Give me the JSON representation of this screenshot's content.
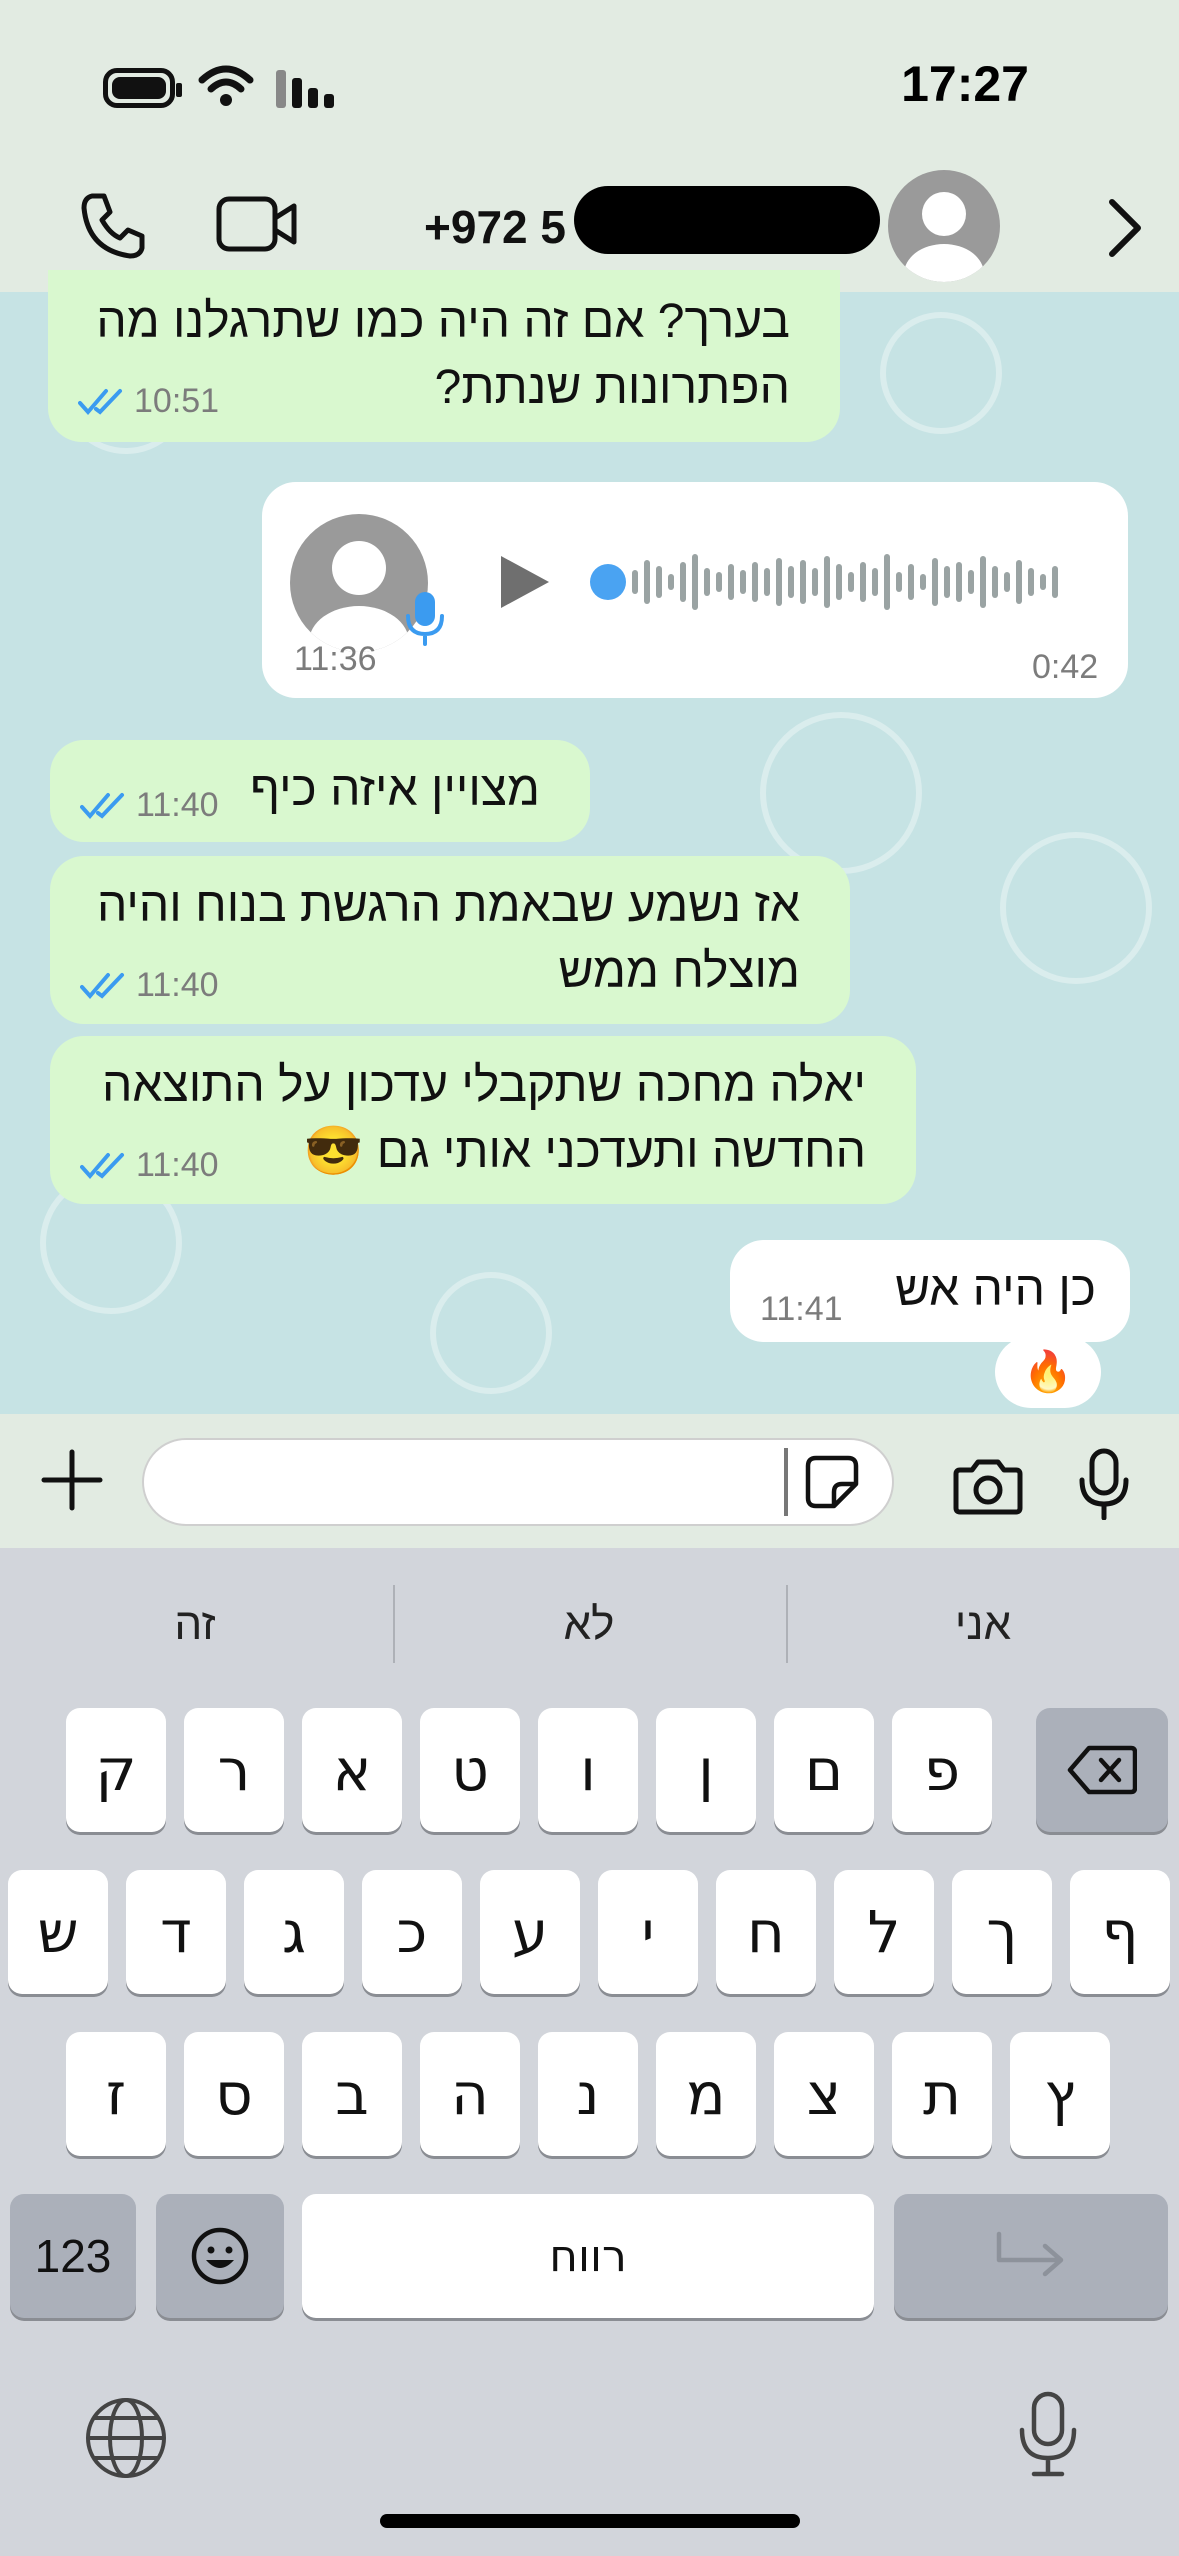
{
  "status": {
    "time": "17:27"
  },
  "header": {
    "contact": "+972 5"
  },
  "messages": {
    "m1": {
      "text1": "בערך? אם זה היה כמו שתרגלנו מה",
      "text2": "הפתרונות שנתת?",
      "time": "10:51"
    },
    "voice": {
      "sent_time": "11:36",
      "duration": "0:42"
    },
    "m3": {
      "text": "מצויין איזה כיף",
      "time": "11:40"
    },
    "m4": {
      "text1": "אז נשמע שבאמת הרגשת בנוח והיה",
      "text2": "מוצלח ממש",
      "time": "11:40"
    },
    "m5": {
      "text1": "יאלה מחכה שתקבלי עדכון על התוצאה",
      "text2": "החדשה ותעדכני אותי גם",
      "emoji": "😎",
      "time": "11:40"
    },
    "m6": {
      "text": "כן היה אש",
      "time": "11:41",
      "reaction": "🔥"
    }
  },
  "input": {
    "placeholder": ""
  },
  "keyboard": {
    "suggestions": [
      "זה",
      "לא",
      "אני"
    ],
    "row1": [
      "ק",
      "ר",
      "א",
      "ט",
      "ו",
      "ן",
      "ם",
      "פ"
    ],
    "row2": [
      "ש",
      "ד",
      "ג",
      "כ",
      "ע",
      "י",
      "ח",
      "ל",
      "ך",
      "ף"
    ],
    "row3": [
      "ז",
      "ס",
      "ב",
      "ה",
      "נ",
      "מ",
      "צ",
      "ת",
      "ץ"
    ],
    "num_label": "123",
    "space_label": "רווח"
  },
  "colors": {
    "outgoing_bubble": "#d9f8cf",
    "incoming_bubble": "#ffffff",
    "chat_bg": "#c6e3e4",
    "read_ticks": "#3b9bf0"
  }
}
